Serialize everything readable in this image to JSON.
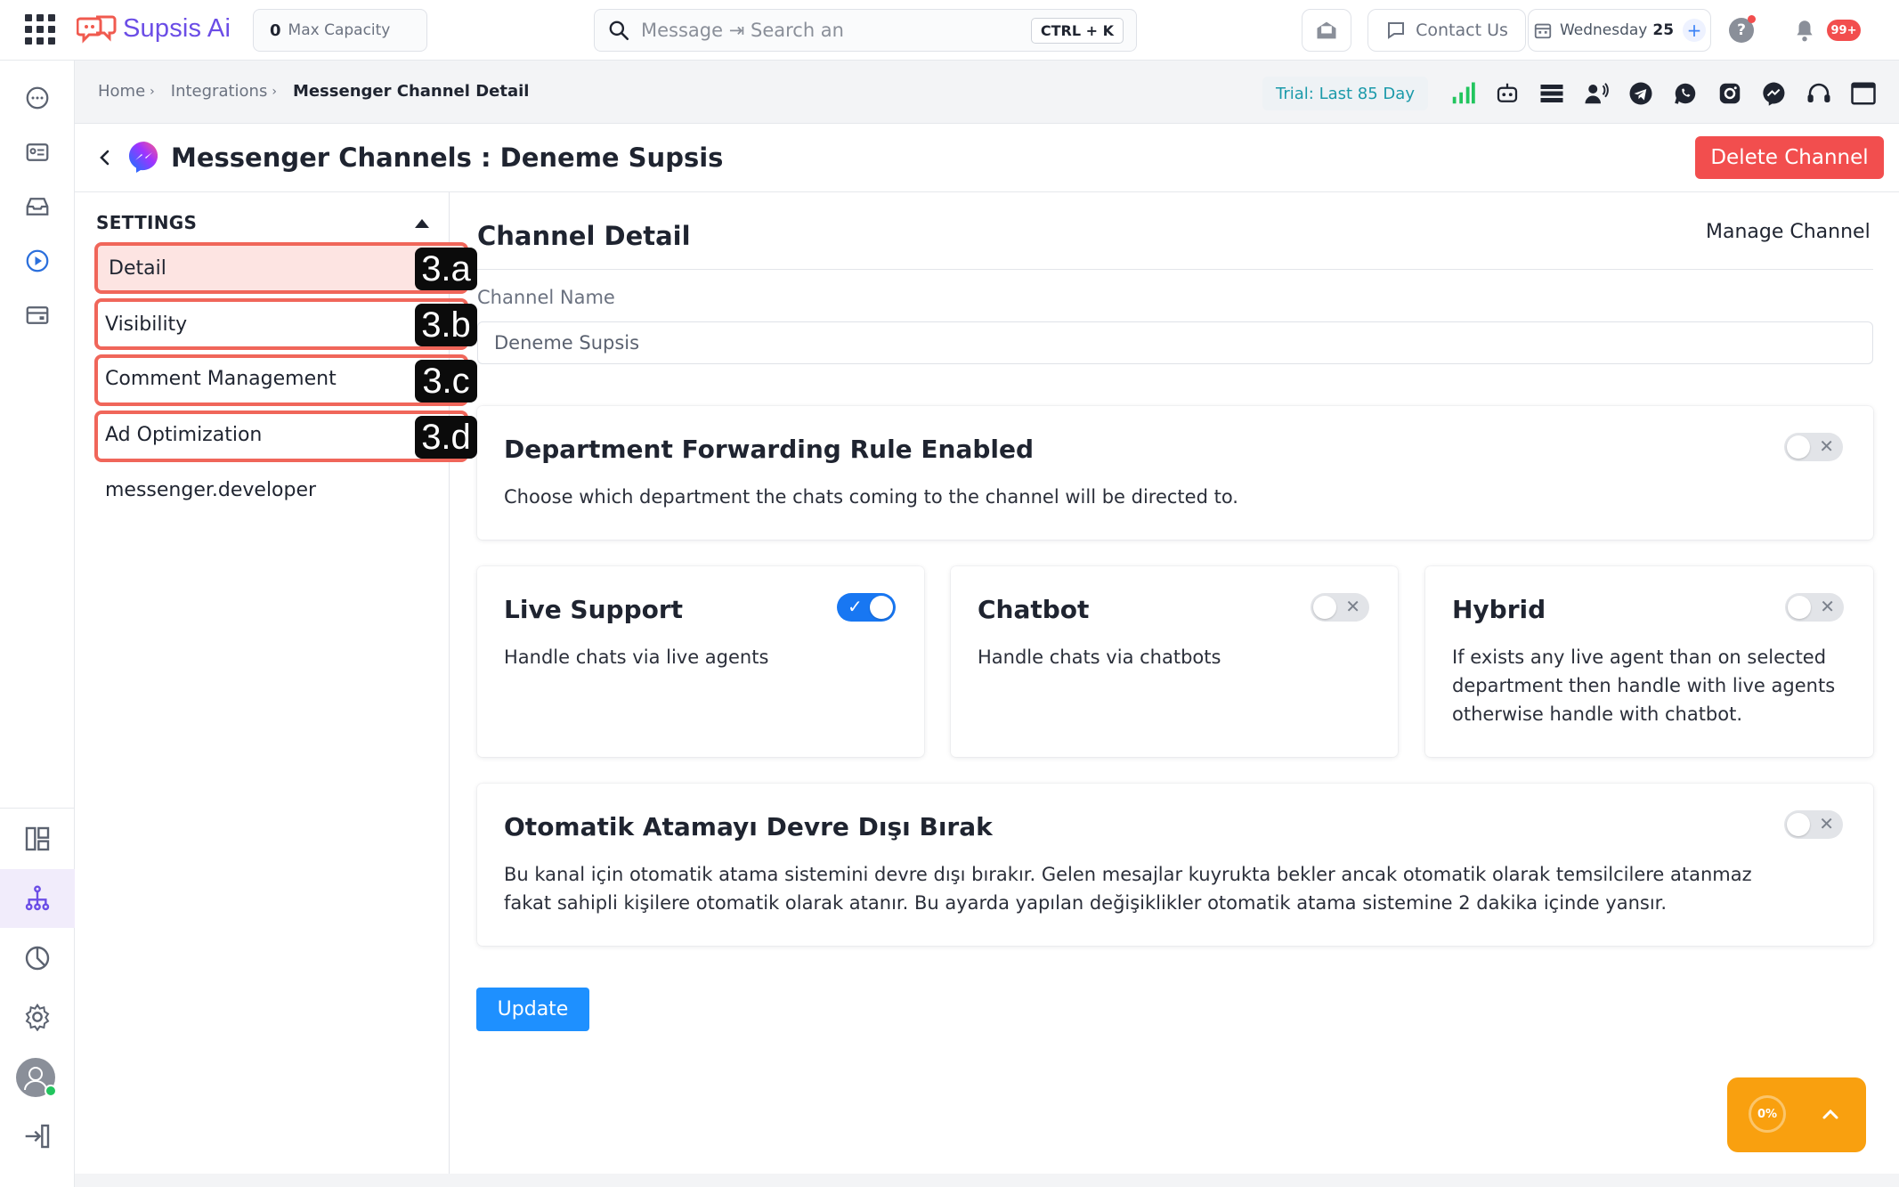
{
  "app": {
    "name": "Supsis Ai"
  },
  "topbar": {
    "capacity": {
      "count": "0",
      "label": "Max Capacity"
    },
    "search": {
      "placeholder": "Message ⇥ Search an",
      "shortcut": "CTRL + K"
    },
    "contact_label": "Contact Us",
    "date": {
      "weekday": "Wednesday",
      "day": "25",
      "plus": "+"
    },
    "help": "?",
    "notifications_badge": "99+"
  },
  "breadcrumb": {
    "items": [
      "Home",
      "Integrations",
      "Messenger Channel Detail"
    ],
    "separator": "›"
  },
  "trial": "Trial: Last 85 Day",
  "header": {
    "title": "Messenger Channels : Deneme Supsis",
    "delete_label": "Delete Channel"
  },
  "settings": {
    "title": "SETTINGS",
    "items": [
      {
        "label": "Detail",
        "badge": "3.a"
      },
      {
        "label": "Visibility",
        "badge": "3.b"
      },
      {
        "label": "Comment Management",
        "badge": "3.c"
      },
      {
        "label": "Ad Optimization",
        "badge": "3.d"
      }
    ],
    "extra_item": "messenger.developer"
  },
  "detail": {
    "title": "Channel Detail",
    "manage_label": "Manage Channel",
    "channel_name_label": "Channel Name",
    "channel_name_value": "Deneme Supsis"
  },
  "cards": {
    "dept": {
      "title": "Department Forwarding Rule Enabled",
      "desc": "Choose which department the chats coming to the channel will be directed to.",
      "enabled": false
    },
    "live": {
      "title": "Live Support",
      "desc": "Handle chats via live agents",
      "enabled": true
    },
    "chatbot": {
      "title": "Chatbot",
      "desc": "Handle chats via chatbots",
      "enabled": false
    },
    "hybrid": {
      "title": "Hybrid",
      "desc": "If exists any live agent than on selected department then handle with live agents otherwise handle with chatbot.",
      "enabled": false
    },
    "auto": {
      "title": "Otomatik Atamayı Devre Dışı Bırak",
      "desc": "Bu kanal için otomatik atama sistemini devre dışı bırakır. Gelen mesajlar kuyrukta bekler ancak otomatik olarak temsilcilere atanmaz fakat sahipli kişilere otomatik olarak atanır. Bu ayarda yapılan değişiklikler otomatik atama sistemine 2 dakika içinde yansır.",
      "enabled": false
    }
  },
  "toggle_symbols": {
    "on": "✓",
    "off": "✕"
  },
  "update_label": "Update",
  "progress": {
    "value": "0%"
  },
  "colors": {
    "brand": "#6b4de6",
    "danger": "#f24e4e",
    "primary": "#1e90ff",
    "toggle_on": "#1877f2",
    "highlight_border": "#f0665a",
    "float": "#f9a00f"
  }
}
